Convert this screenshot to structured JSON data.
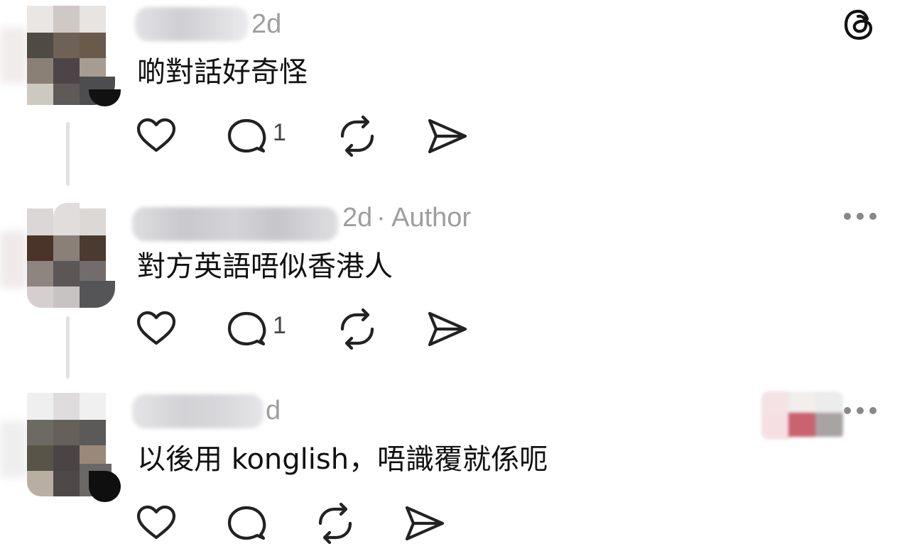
{
  "app": {
    "logo_icon": "threads-logo-icon"
  },
  "comments": [
    {
      "timestamp": "2d",
      "author_tag": "",
      "text": "啲對話好奇怪",
      "reply_count": "1",
      "has_more_menu": false
    },
    {
      "timestamp": "2d",
      "author_tag": "· Author",
      "text": "對方英語唔似香港人",
      "reply_count": "1",
      "has_more_menu": true
    },
    {
      "timestamp": "d",
      "author_tag": "",
      "text": "以後用 konglish，唔識覆就係呃",
      "reply_count": "",
      "has_more_menu": true
    }
  ],
  "icons": {
    "like": "heart-icon",
    "reply": "speech-bubble-icon",
    "repost": "repost-icon",
    "share": "paper-plane-icon",
    "more": "more-horizontal-icon"
  },
  "colors": {
    "text_primary": "#111111",
    "text_secondary": "#9e9e9e",
    "icon_stroke": "#222222",
    "thread_line": "#e1e1e1"
  }
}
